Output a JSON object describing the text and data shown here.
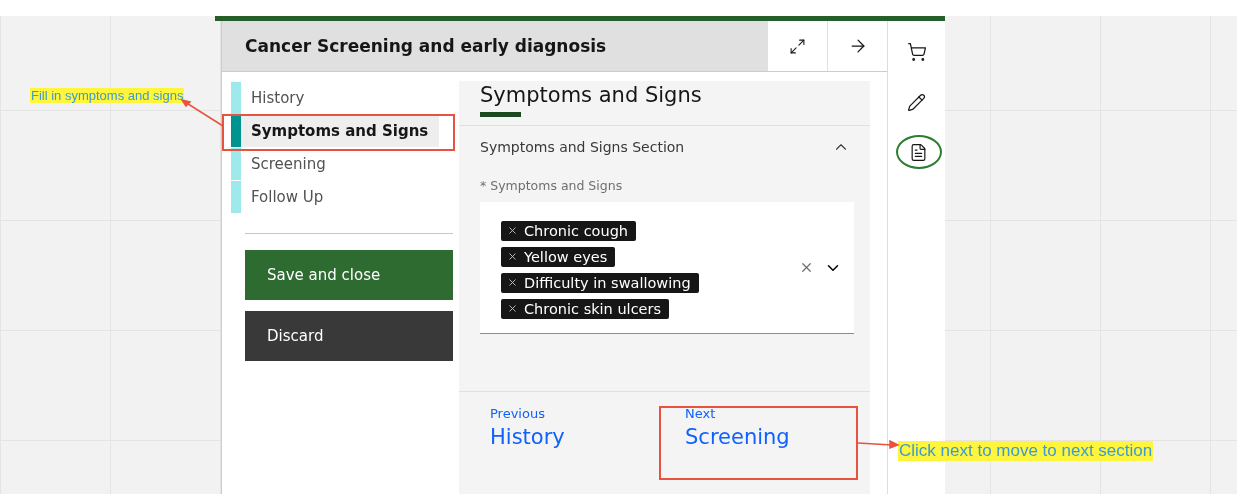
{
  "panel": {
    "title": "Cancer Screening and early diagnosis"
  },
  "nav": [
    {
      "label": "History",
      "selected": false
    },
    {
      "label": "Symptoms and Signs",
      "selected": true
    },
    {
      "label": "Screening",
      "selected": false
    },
    {
      "label": "Follow Up",
      "selected": false
    }
  ],
  "actions": [
    {
      "label": "Save and close",
      "kind": "primary"
    },
    {
      "label": "Discard",
      "kind": "secondary"
    }
  ],
  "content": {
    "heading": "Symptoms and Signs",
    "section": {
      "title": "Symptoms and Signs Section",
      "expanded": true
    },
    "field_label": "* Symptoms and Signs",
    "tags": [
      "Chronic cough",
      "Yellow eyes",
      "Difficulty in swallowing",
      "Chronic skin ulcers"
    ]
  },
  "footer": {
    "previous": {
      "caption": "Previous",
      "label": "History"
    },
    "next": {
      "caption": "Next",
      "label": "Screening"
    }
  },
  "rail": [
    {
      "kind": "cart",
      "selected": false
    },
    {
      "kind": "pencil",
      "selected": false
    },
    {
      "kind": "document",
      "selected": true
    }
  ],
  "annotations": [
    "Fill in symptoms and signs",
    "Click next to move to next section"
  ]
}
